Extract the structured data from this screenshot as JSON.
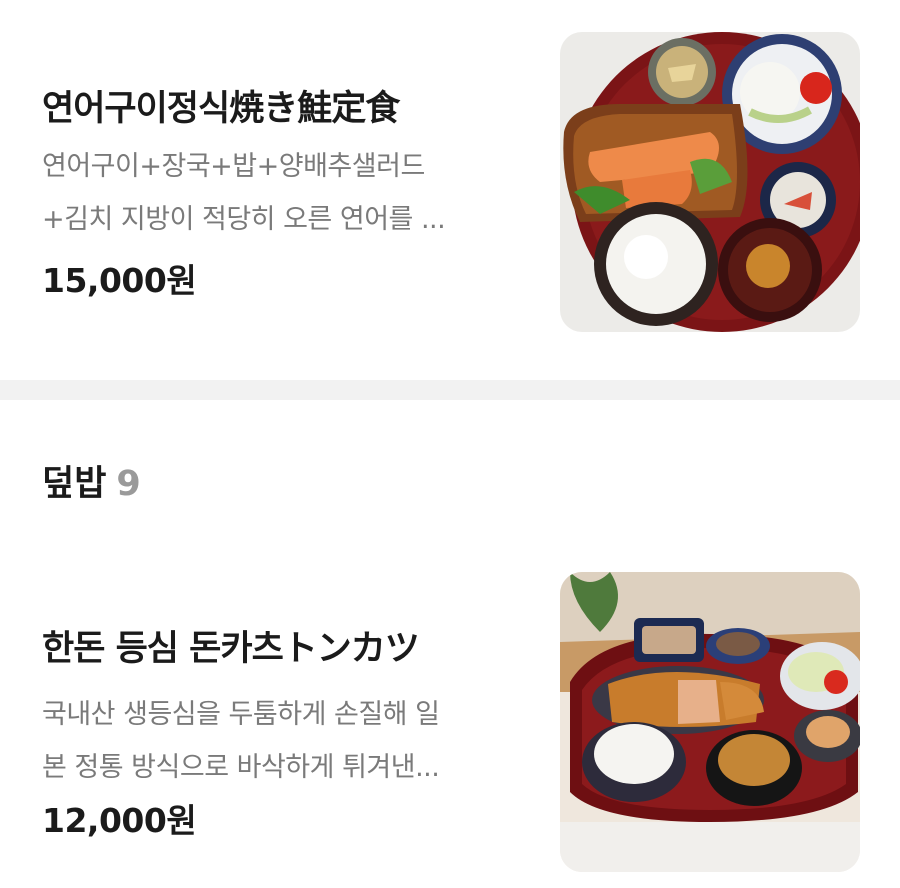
{
  "menu_items": [
    {
      "title": "연어구이정식焼き鮭定食",
      "description_line1": "연어구이+장국+밥+양배추샐러드",
      "description_line2": "+김치 지방이 적당히 오른 연어를 ...",
      "price": "15,000원",
      "image_icon": "salmon-set-meal-photo"
    },
    {
      "title": "한돈 등심 돈카츠トンカツ",
      "description_line1": "국내산 생등심을 두툼하게 손질해 일",
      "description_line2": "본 정통 방식으로 바삭하게 튀겨낸...",
      "price": "12,000원",
      "image_icon": "tonkatsu-set-meal-photo"
    }
  ],
  "section": {
    "name": "덮밥",
    "count": "9"
  },
  "colors": {
    "divider": "#f2f2f2",
    "tray_red": "#7a1214",
    "secondary_text": "#7a7a7a"
  }
}
